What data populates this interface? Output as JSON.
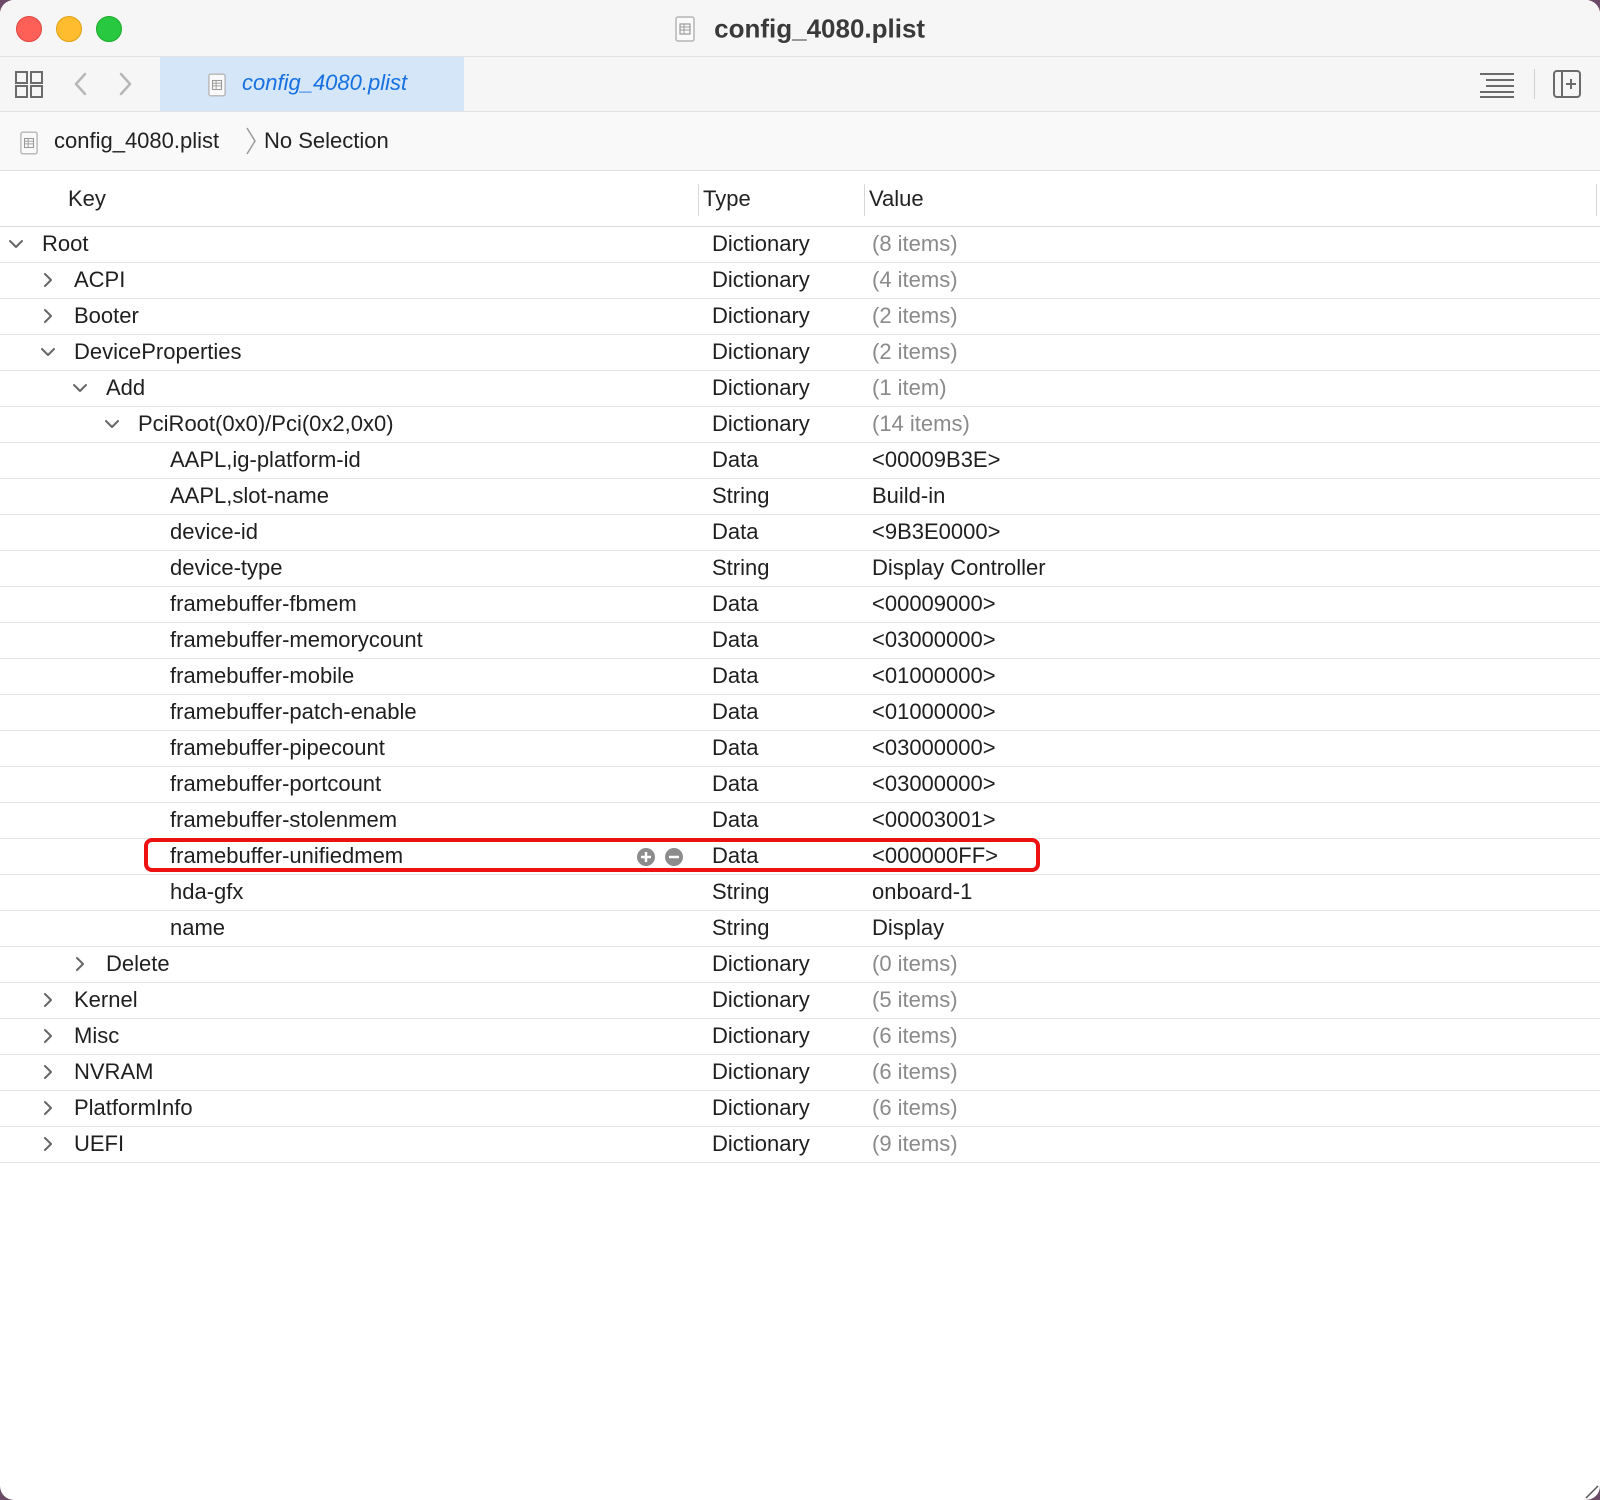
{
  "window": {
    "title": "config_4080.plist",
    "tab_label": "config_4080.plist"
  },
  "icons": [
    "grid-icon",
    "back-chevron-icon",
    "forward-chevron-icon",
    "document-icon",
    "list-icon",
    "add-editor-icon"
  ],
  "breadcrumb": {
    "file": "config_4080.plist",
    "selection": "No Selection"
  },
  "columns": {
    "key": "Key",
    "type": "Type",
    "value": "Value"
  },
  "rows": [
    {
      "key": "Root",
      "type": "Dictionary",
      "value": "(8 items)",
      "depth": 0,
      "disclosure": "expanded",
      "count": true
    },
    {
      "key": "ACPI",
      "type": "Dictionary",
      "value": "(4 items)",
      "depth": 1,
      "disclosure": "collapsed",
      "count": true
    },
    {
      "key": "Booter",
      "type": "Dictionary",
      "value": "(2 items)",
      "depth": 1,
      "disclosure": "collapsed",
      "count": true
    },
    {
      "key": "DeviceProperties",
      "type": "Dictionary",
      "value": "(2 items)",
      "depth": 1,
      "disclosure": "expanded",
      "count": true
    },
    {
      "key": "Add",
      "type": "Dictionary",
      "value": "(1 item)",
      "depth": 2,
      "disclosure": "expanded",
      "count": true
    },
    {
      "key": "PciRoot(0x0)/Pci(0x2,0x0)",
      "type": "Dictionary",
      "value": "(14 items)",
      "depth": 3,
      "disclosure": "expanded",
      "count": true
    },
    {
      "key": "AAPL,ig-platform-id",
      "type": "Data",
      "value": "<00009B3E>",
      "depth": 4,
      "disclosure": "none",
      "count": false
    },
    {
      "key": "AAPL,slot-name",
      "type": "String",
      "value": "Build-in",
      "depth": 4,
      "disclosure": "none",
      "count": false
    },
    {
      "key": "device-id",
      "type": "Data",
      "value": "<9B3E0000>",
      "depth": 4,
      "disclosure": "none",
      "count": false
    },
    {
      "key": "device-type",
      "type": "String",
      "value": "Display Controller",
      "depth": 4,
      "disclosure": "none",
      "count": false
    },
    {
      "key": "framebuffer-fbmem",
      "type": "Data",
      "value": "<00009000>",
      "depth": 4,
      "disclosure": "none",
      "count": false
    },
    {
      "key": "framebuffer-memorycount",
      "type": "Data",
      "value": "<03000000>",
      "depth": 4,
      "disclosure": "none",
      "count": false
    },
    {
      "key": "framebuffer-mobile",
      "type": "Data",
      "value": "<01000000>",
      "depth": 4,
      "disclosure": "none",
      "count": false
    },
    {
      "key": "framebuffer-patch-enable",
      "type": "Data",
      "value": "<01000000>",
      "depth": 4,
      "disclosure": "none",
      "count": false
    },
    {
      "key": "framebuffer-pipecount",
      "type": "Data",
      "value": "<03000000>",
      "depth": 4,
      "disclosure": "none",
      "count": false
    },
    {
      "key": "framebuffer-portcount",
      "type": "Data",
      "value": "<03000000>",
      "depth": 4,
      "disclosure": "none",
      "count": false
    },
    {
      "key": "framebuffer-stolenmem",
      "type": "Data",
      "value": "<00003001>",
      "depth": 4,
      "disclosure": "none",
      "count": false
    },
    {
      "key": "framebuffer-unifiedmem",
      "type": "Data",
      "value": "<000000FF>",
      "depth": 4,
      "disclosure": "none",
      "count": false,
      "hover": true
    },
    {
      "key": "hda-gfx",
      "type": "String",
      "value": "onboard-1",
      "depth": 4,
      "disclosure": "none",
      "count": false
    },
    {
      "key": "name",
      "type": "String",
      "value": "Display",
      "depth": 4,
      "disclosure": "none",
      "count": false
    },
    {
      "key": "Delete",
      "type": "Dictionary",
      "value": "(0 items)",
      "depth": 2,
      "disclosure": "collapsed",
      "count": true
    },
    {
      "key": "Kernel",
      "type": "Dictionary",
      "value": "(5 items)",
      "depth": 1,
      "disclosure": "collapsed",
      "count": true
    },
    {
      "key": "Misc",
      "type": "Dictionary",
      "value": "(6 items)",
      "depth": 1,
      "disclosure": "collapsed",
      "count": true
    },
    {
      "key": "NVRAM",
      "type": "Dictionary",
      "value": "(6 items)",
      "depth": 1,
      "disclosure": "collapsed",
      "count": true
    },
    {
      "key": "PlatformInfo",
      "type": "Dictionary",
      "value": "(6 items)",
      "depth": 1,
      "disclosure": "collapsed",
      "count": true
    },
    {
      "key": "UEFI",
      "type": "Dictionary",
      "value": "(9 items)",
      "depth": 1,
      "disclosure": "collapsed",
      "count": true
    }
  ],
  "colors": {
    "accent": "#1670e0",
    "tab_active_bg": "#d5e6f8",
    "highlight_box": "#ee1111",
    "count_text": "#8a8a8a"
  }
}
